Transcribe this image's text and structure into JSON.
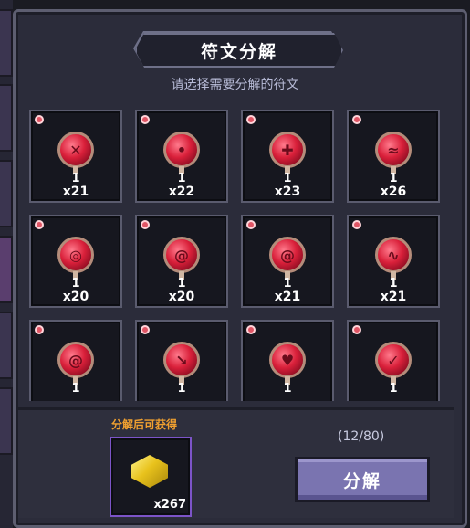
{
  "title": "符文分解",
  "subtitle": "请选择需要分解的符文",
  "runes": [
    {
      "level": "1",
      "count": "x21",
      "glyph": "✕"
    },
    {
      "level": "1",
      "count": "x22",
      "glyph": "•"
    },
    {
      "level": "1",
      "count": "x23",
      "glyph": "✚"
    },
    {
      "level": "1",
      "count": "x26",
      "glyph": "≈"
    },
    {
      "level": "1",
      "count": "x20",
      "glyph": "◎"
    },
    {
      "level": "1",
      "count": "x20",
      "glyph": "@"
    },
    {
      "level": "1",
      "count": "x21",
      "glyph": "@"
    },
    {
      "level": "1",
      "count": "x21",
      "glyph": "∿"
    },
    {
      "level": "1",
      "count": "",
      "glyph": "@"
    },
    {
      "level": "1",
      "count": "",
      "glyph": "↘"
    },
    {
      "level": "1",
      "count": "",
      "glyph": "♥"
    },
    {
      "level": "1",
      "count": "",
      "glyph": "✓"
    }
  ],
  "reward": {
    "label": "分解后可获得",
    "count": "x267"
  },
  "capacity": "(12/80)",
  "decompose_button": "分解"
}
